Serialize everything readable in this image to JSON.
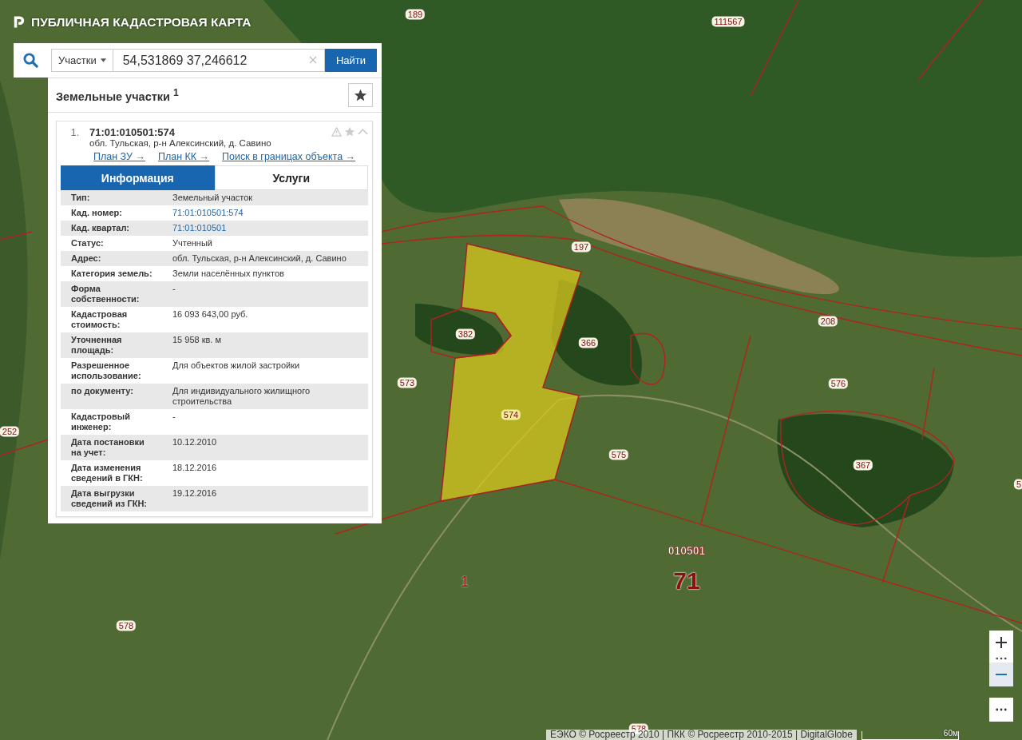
{
  "header": {
    "title": "ПУБЛИЧНАЯ КАДАСТРОВАЯ КАРТА"
  },
  "search": {
    "category": "Участки",
    "value": "54,531869 37,246612",
    "button": "Найти"
  },
  "results": {
    "title": "Земельные участки $^{1}$",
    "item": {
      "number": "1.",
      "cadastral_number": "71:01:010501:574",
      "address": "обл. Тульская, р-н Алексинский, д. Савино"
    },
    "links": [
      "План ЗУ →",
      "План КК →",
      "Поиск в границах объекта →"
    ],
    "tabs": [
      {
        "label": "Информация",
        "selected": true
      },
      {
        "label": "Услуги",
        "selected": false
      }
    ],
    "rows": [
      {
        "label": "Тип:",
        "value": "Земельный участок",
        "kind": "text"
      },
      {
        "label": "Кад. номер:",
        "value": "71:01:010501:574",
        "kind": "link"
      },
      {
        "label": "Кад. квартал:",
        "value": "71:01:010501",
        "kind": "link"
      },
      {
        "label": "Статус:",
        "value": "Учтенный",
        "kind": "text"
      },
      {
        "label": "Адрес:",
        "value": "обл. Тульская, р-н Алексинский, д. Савино",
        "kind": "text"
      },
      {
        "label": "Категория земель:",
        "value": "Земли населённых пунктов",
        "kind": "text"
      },
      {
        "label": "Форма собственности:",
        "value": "-",
        "kind": "text"
      },
      {
        "label": "Кадастровая стоимость:",
        "value": "16 093 643,00 руб.",
        "kind": "text"
      },
      {
        "label": "Уточненная площадь:",
        "value": "15 958 кв. м",
        "kind": "text"
      },
      {
        "label": "Разрешенное использование:",
        "value": "Для объектов жилой застройки",
        "kind": "text"
      },
      {
        "label": "по документу:",
        "value": "Для индивидуального жилищного строительства",
        "kind": "text"
      },
      {
        "label": "Кадастровый инженер:",
        "value": "-",
        "kind": "text"
      },
      {
        "label": "Дата постановки на учет:",
        "value": "10.12.2010",
        "kind": "text"
      },
      {
        "label": "Дата изменения сведений в ГКН:",
        "value": "18.12.2016",
        "kind": "text"
      },
      {
        "label": "Дата выгрузки сведений из ГКН:",
        "value": "19.12.2016",
        "kind": "text"
      }
    ]
  },
  "map": {
    "labels": [
      {
        "text": "189",
        "kind": "parcel"
      },
      {
        "text": "111567",
        "kind": "parcel"
      },
      {
        "text": "197",
        "kind": "parcel"
      },
      {
        "text": "382",
        "kind": "parcel"
      },
      {
        "text": "366",
        "kind": "parcel"
      },
      {
        "text": "208",
        "kind": "parcel"
      },
      {
        "text": "573",
        "kind": "parcel"
      },
      {
        "text": "574",
        "kind": "selected"
      },
      {
        "text": "576",
        "kind": "parcel"
      },
      {
        "text": "252",
        "kind": "parcel"
      },
      {
        "text": "575",
        "kind": "parcel"
      },
      {
        "text": "367",
        "kind": "parcel"
      },
      {
        "text": "578",
        "kind": "parcel"
      },
      {
        "text": "578",
        "kind": "parcel"
      },
      {
        "text": "010501",
        "kind": "quarter"
      },
      {
        "text": "71",
        "kind": "district"
      },
      {
        "text": "1",
        "kind": "area"
      },
      {
        "text": "5",
        "kind": "parcel"
      }
    ],
    "attribution": "ЕЭКО © Росреестр 2010 | ПКК © Росреестр 2010-2015 | DigitalGlobe",
    "scale": "60м"
  }
}
